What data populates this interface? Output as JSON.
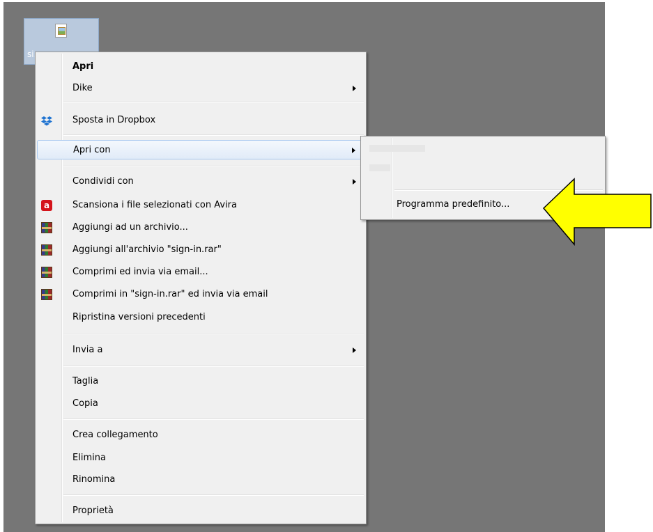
{
  "desktop": {
    "icon_label": "si..."
  },
  "context_menu": {
    "items": [
      {
        "label": "Apri",
        "bold": true
      },
      {
        "label": "Dike",
        "submenu": true
      },
      {
        "label": "Sposta in Dropbox",
        "icon": "dropbox-icon"
      },
      {
        "label": "Apri con",
        "submenu": true,
        "highlighted": true
      },
      {
        "label": "Condividi con",
        "submenu": true
      },
      {
        "label": "Scansiona i file selezionati con Avira",
        "icon": "avira-icon"
      },
      {
        "label": "Aggiungi ad un archivio...",
        "icon": "winrar-icon"
      },
      {
        "label": "Aggiungi all'archivio \"sign-in.rar\"",
        "icon": "winrar-icon"
      },
      {
        "label": "Comprimi ed invia via email...",
        "icon": "winrar-icon"
      },
      {
        "label": "Comprimi in \"sign-in.rar\" ed invia via email",
        "icon": "winrar-icon"
      },
      {
        "label": "Ripristina versioni precedenti"
      },
      {
        "label": "Invia a",
        "submenu": true
      },
      {
        "label": "Taglia"
      },
      {
        "label": "Copia"
      },
      {
        "label": "Crea collegamento"
      },
      {
        "label": "Elimina"
      },
      {
        "label": "Rinomina"
      },
      {
        "label": "Proprietà"
      }
    ]
  },
  "submenu": {
    "item_label": "Programma predefinito..."
  },
  "callout": {
    "icon": "yellow-arrow-icon",
    "color": "#ffff00"
  }
}
